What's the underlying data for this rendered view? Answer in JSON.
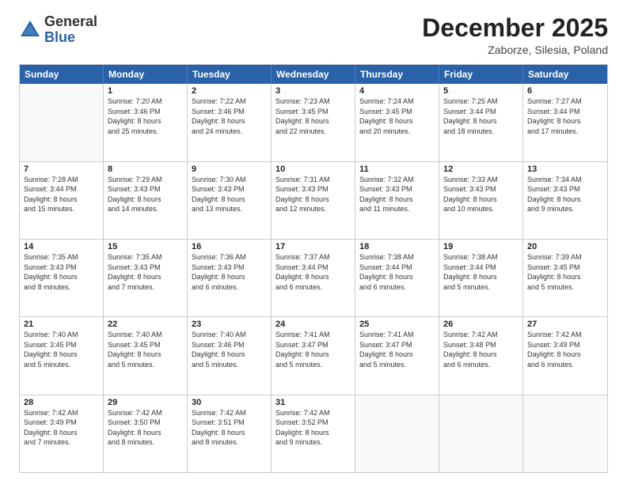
{
  "header": {
    "logo_general": "General",
    "logo_blue": "Blue",
    "month_title": "December 2025",
    "location": "Zaborze, Silesia, Poland"
  },
  "days_of_week": [
    "Sunday",
    "Monday",
    "Tuesday",
    "Wednesday",
    "Thursday",
    "Friday",
    "Saturday"
  ],
  "weeks": [
    [
      {
        "num": "",
        "lines": [],
        "empty": true
      },
      {
        "num": "1",
        "lines": [
          "Sunrise: 7:20 AM",
          "Sunset: 3:46 PM",
          "Daylight: 8 hours",
          "and 25 minutes."
        ]
      },
      {
        "num": "2",
        "lines": [
          "Sunrise: 7:22 AM",
          "Sunset: 3:46 PM",
          "Daylight: 8 hours",
          "and 24 minutes."
        ]
      },
      {
        "num": "3",
        "lines": [
          "Sunrise: 7:23 AM",
          "Sunset: 3:45 PM",
          "Daylight: 8 hours",
          "and 22 minutes."
        ]
      },
      {
        "num": "4",
        "lines": [
          "Sunrise: 7:24 AM",
          "Sunset: 3:45 PM",
          "Daylight: 8 hours",
          "and 20 minutes."
        ]
      },
      {
        "num": "5",
        "lines": [
          "Sunrise: 7:25 AM",
          "Sunset: 3:44 PM",
          "Daylight: 8 hours",
          "and 18 minutes."
        ]
      },
      {
        "num": "6",
        "lines": [
          "Sunrise: 7:27 AM",
          "Sunset: 3:44 PM",
          "Daylight: 8 hours",
          "and 17 minutes."
        ]
      }
    ],
    [
      {
        "num": "7",
        "lines": [
          "Sunrise: 7:28 AM",
          "Sunset: 3:44 PM",
          "Daylight: 8 hours",
          "and 15 minutes."
        ]
      },
      {
        "num": "8",
        "lines": [
          "Sunrise: 7:29 AM",
          "Sunset: 3:43 PM",
          "Daylight: 8 hours",
          "and 14 minutes."
        ]
      },
      {
        "num": "9",
        "lines": [
          "Sunrise: 7:30 AM",
          "Sunset: 3:43 PM",
          "Daylight: 8 hours",
          "and 13 minutes."
        ]
      },
      {
        "num": "10",
        "lines": [
          "Sunrise: 7:31 AM",
          "Sunset: 3:43 PM",
          "Daylight: 8 hours",
          "and 12 minutes."
        ]
      },
      {
        "num": "11",
        "lines": [
          "Sunrise: 7:32 AM",
          "Sunset: 3:43 PM",
          "Daylight: 8 hours",
          "and 11 minutes."
        ]
      },
      {
        "num": "12",
        "lines": [
          "Sunrise: 7:33 AM",
          "Sunset: 3:43 PM",
          "Daylight: 8 hours",
          "and 10 minutes."
        ]
      },
      {
        "num": "13",
        "lines": [
          "Sunrise: 7:34 AM",
          "Sunset: 3:43 PM",
          "Daylight: 8 hours",
          "and 9 minutes."
        ]
      }
    ],
    [
      {
        "num": "14",
        "lines": [
          "Sunrise: 7:35 AM",
          "Sunset: 3:43 PM",
          "Daylight: 8 hours",
          "and 8 minutes."
        ]
      },
      {
        "num": "15",
        "lines": [
          "Sunrise: 7:35 AM",
          "Sunset: 3:43 PM",
          "Daylight: 8 hours",
          "and 7 minutes."
        ]
      },
      {
        "num": "16",
        "lines": [
          "Sunrise: 7:36 AM",
          "Sunset: 3:43 PM",
          "Daylight: 8 hours",
          "and 6 minutes."
        ]
      },
      {
        "num": "17",
        "lines": [
          "Sunrise: 7:37 AM",
          "Sunset: 3:44 PM",
          "Daylight: 8 hours",
          "and 6 minutes."
        ]
      },
      {
        "num": "18",
        "lines": [
          "Sunrise: 7:38 AM",
          "Sunset: 3:44 PM",
          "Daylight: 8 hours",
          "and 6 minutes."
        ]
      },
      {
        "num": "19",
        "lines": [
          "Sunrise: 7:38 AM",
          "Sunset: 3:44 PM",
          "Daylight: 8 hours",
          "and 5 minutes."
        ]
      },
      {
        "num": "20",
        "lines": [
          "Sunrise: 7:39 AM",
          "Sunset: 3:45 PM",
          "Daylight: 8 hours",
          "and 5 minutes."
        ]
      }
    ],
    [
      {
        "num": "21",
        "lines": [
          "Sunrise: 7:40 AM",
          "Sunset: 3:45 PM",
          "Daylight: 8 hours",
          "and 5 minutes."
        ]
      },
      {
        "num": "22",
        "lines": [
          "Sunrise: 7:40 AM",
          "Sunset: 3:45 PM",
          "Daylight: 8 hours",
          "and 5 minutes."
        ]
      },
      {
        "num": "23",
        "lines": [
          "Sunrise: 7:40 AM",
          "Sunset: 3:46 PM",
          "Daylight: 8 hours",
          "and 5 minutes."
        ]
      },
      {
        "num": "24",
        "lines": [
          "Sunrise: 7:41 AM",
          "Sunset: 3:47 PM",
          "Daylight: 8 hours",
          "and 5 minutes."
        ]
      },
      {
        "num": "25",
        "lines": [
          "Sunrise: 7:41 AM",
          "Sunset: 3:47 PM",
          "Daylight: 8 hours",
          "and 5 minutes."
        ]
      },
      {
        "num": "26",
        "lines": [
          "Sunrise: 7:42 AM",
          "Sunset: 3:48 PM",
          "Daylight: 8 hours",
          "and 6 minutes."
        ]
      },
      {
        "num": "27",
        "lines": [
          "Sunrise: 7:42 AM",
          "Sunset: 3:49 PM",
          "Daylight: 8 hours",
          "and 6 minutes."
        ]
      }
    ],
    [
      {
        "num": "28",
        "lines": [
          "Sunrise: 7:42 AM",
          "Sunset: 3:49 PM",
          "Daylight: 8 hours",
          "and 7 minutes."
        ]
      },
      {
        "num": "29",
        "lines": [
          "Sunrise: 7:42 AM",
          "Sunset: 3:50 PM",
          "Daylight: 8 hours",
          "and 8 minutes."
        ]
      },
      {
        "num": "30",
        "lines": [
          "Sunrise: 7:42 AM",
          "Sunset: 3:51 PM",
          "Daylight: 8 hours",
          "and 8 minutes."
        ]
      },
      {
        "num": "31",
        "lines": [
          "Sunrise: 7:42 AM",
          "Sunset: 3:52 PM",
          "Daylight: 8 hours",
          "and 9 minutes."
        ]
      },
      {
        "num": "",
        "lines": [],
        "empty": true
      },
      {
        "num": "",
        "lines": [],
        "empty": true
      },
      {
        "num": "",
        "lines": [],
        "empty": true
      }
    ]
  ]
}
